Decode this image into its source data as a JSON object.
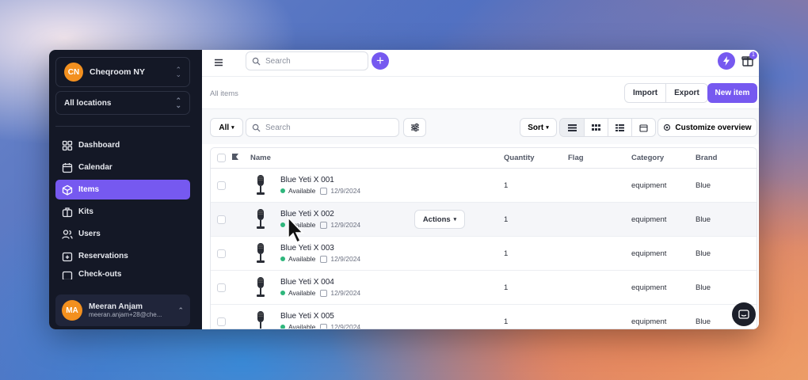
{
  "org": {
    "initials": "CN",
    "name": "Cheqroom NY"
  },
  "location": {
    "label": "All locations"
  },
  "nav": [
    {
      "label": "Dashboard",
      "icon": "dashboard-icon"
    },
    {
      "label": "Calendar",
      "icon": "calendar-icon"
    },
    {
      "label": "Items",
      "icon": "box-icon",
      "active": true
    },
    {
      "label": "Kits",
      "icon": "kit-icon"
    },
    {
      "label": "Users",
      "icon": "users-icon"
    },
    {
      "label": "Reservations",
      "icon": "reservation-icon"
    },
    {
      "label": "Check-outs",
      "icon": "checkout-icon"
    }
  ],
  "user": {
    "initials": "MA",
    "name": "Meeran Anjam",
    "email": "meeran.anjam+28@che..."
  },
  "topbar": {
    "search_placeholder": "Search",
    "gift_count": "1"
  },
  "breadcrumb": "All items",
  "header_buttons": {
    "import": "Import",
    "export": "Export",
    "new_item": "New item"
  },
  "filters": {
    "all": "All",
    "search_placeholder": "Search",
    "sort": "Sort",
    "customize": "Customize overview"
  },
  "table": {
    "columns": {
      "name": "Name",
      "quantity": "Quantity",
      "flag": "Flag",
      "category": "Category",
      "brand": "Brand"
    },
    "rows": [
      {
        "name": "Blue Yeti X 001",
        "status": "Available",
        "date": "12/9/2024",
        "quantity": "1",
        "flag": "",
        "category": "equipment",
        "brand": "Blue"
      },
      {
        "name": "Blue Yeti X 002",
        "status": "Available",
        "date": "12/9/2024",
        "quantity": "1",
        "flag": "",
        "category": "equipment",
        "brand": "Blue"
      },
      {
        "name": "Blue Yeti X 003",
        "status": "Available",
        "date": "12/9/2024",
        "quantity": "1",
        "flag": "",
        "category": "equipment",
        "brand": "Blue"
      },
      {
        "name": "Blue Yeti X 004",
        "status": "Available",
        "date": "12/9/2024",
        "quantity": "1",
        "flag": "",
        "category": "equipment",
        "brand": "Blue"
      },
      {
        "name": "Blue Yeti X 005",
        "status": "Available",
        "date": "12/9/2024",
        "quantity": "1",
        "flag": "",
        "category": "equipment",
        "brand": "Blue"
      }
    ],
    "row_actions_label": "Actions"
  },
  "colors": {
    "accent": "#7659f0",
    "sidebar_bg": "#141826",
    "available": "#2fb67c",
    "avatar": "#f3901f"
  }
}
